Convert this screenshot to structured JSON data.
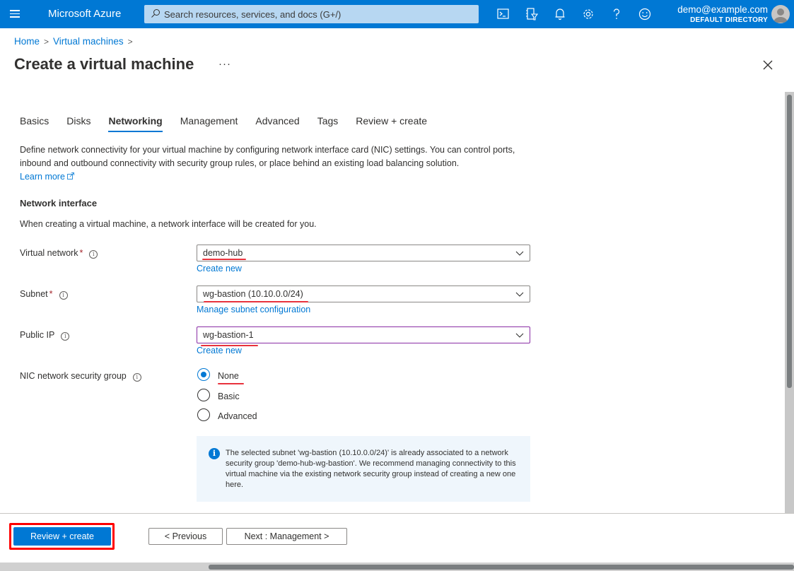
{
  "topbar": {
    "brand": "Microsoft Azure",
    "search_placeholder": "Search resources, services, and docs (G+/)",
    "icons": [
      "cloud-shell-icon",
      "directory-filter-icon",
      "notifications-icon",
      "settings-icon",
      "help-icon",
      "feedback-icon"
    ],
    "user_email": "demo@example.com",
    "user_directory": "DEFAULT DIRECTORY"
  },
  "breadcrumb": [
    {
      "label": "Home"
    },
    {
      "label": "Virtual machines"
    }
  ],
  "page": {
    "title": "Create a virtual machine",
    "more_label": "···"
  },
  "tabs": [
    {
      "label": "Basics",
      "active": false
    },
    {
      "label": "Disks",
      "active": false
    },
    {
      "label": "Networking",
      "active": true
    },
    {
      "label": "Management",
      "active": false
    },
    {
      "label": "Advanced",
      "active": false
    },
    {
      "label": "Tags",
      "active": false
    },
    {
      "label": "Review + create",
      "active": false
    }
  ],
  "intro": {
    "text": "Define network connectivity for your virtual machine by configuring network interface card (NIC) settings. You can control ports, inbound and outbound connectivity with security group rules, or place behind an existing load balancing solution.",
    "learn_more": "Learn more"
  },
  "network_interface": {
    "heading": "Network interface",
    "description": "When creating a virtual machine, a network interface will be created for you.",
    "fields": {
      "virtual_network": {
        "label": "Virtual network",
        "required": "*",
        "value": "demo-hub",
        "link": "Create new"
      },
      "subnet": {
        "label": "Subnet",
        "required": "*",
        "value": "wg-bastion (10.10.0.0/24)",
        "link": "Manage subnet configuration"
      },
      "public_ip": {
        "label": "Public IP",
        "value": "wg-bastion-1",
        "link": "Create new"
      },
      "nic_nsg": {
        "label": "NIC network security group",
        "options": [
          {
            "label": "None",
            "checked": true
          },
          {
            "label": "Basic",
            "checked": false
          },
          {
            "label": "Advanced",
            "checked": false
          }
        ]
      }
    },
    "info_message": "The selected subnet 'wg-bastion (10.10.0.0/24)' is already associated to a network security group 'demo-hub-wg-bastion'. We recommend managing connectivity to this virtual machine via the existing network security group instead of creating a new one here."
  },
  "footer": {
    "review_create": "Review + create",
    "previous": "< Previous",
    "next": "Next : Management >"
  },
  "colors": {
    "accent": "#0078d4",
    "highlight": "#ff0000",
    "annotation_underline": "#e8323c",
    "focus_border": "#8a2da5"
  }
}
